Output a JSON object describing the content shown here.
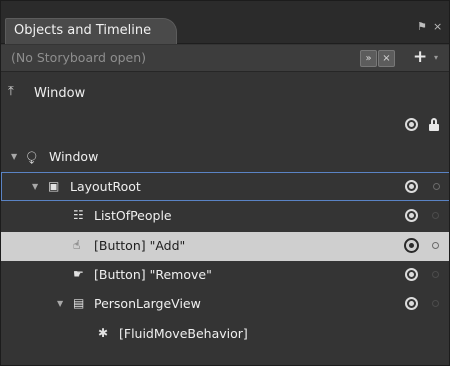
{
  "panel": {
    "tab_title": "Objects and Timeline",
    "pin_glyph": "⚑",
    "close_glyph": "×"
  },
  "storyboard": {
    "label": "(No Storyboard open)",
    "expand_glyph": "»",
    "close_glyph": "×",
    "add_glyph": "+",
    "menu_glyph": "▾"
  },
  "scope": {
    "icon_glyph": "⤒",
    "label": "Window"
  },
  "tree": [
    {
      "label": "Window",
      "depth": 0,
      "expander": "▼",
      "icon": "⧬"
    },
    {
      "label": "LayoutRoot",
      "depth": 1,
      "expander": "▼",
      "icon": "▣"
    },
    {
      "label": "ListOfPeople",
      "depth": 2,
      "expander": "",
      "icon": "☷"
    },
    {
      "label": "[Button] \"Add\"",
      "depth": 2,
      "expander": "",
      "icon": "☝"
    },
    {
      "label": "[Button] \"Remove\"",
      "depth": 2,
      "expander": "",
      "icon": "☛"
    },
    {
      "label": "PersonLargeView",
      "depth": 2,
      "expander": "▼",
      "icon": "▤"
    },
    {
      "label": "[FluidMoveBehavior]",
      "depth": 3,
      "expander": "",
      "icon": "✱"
    }
  ]
}
